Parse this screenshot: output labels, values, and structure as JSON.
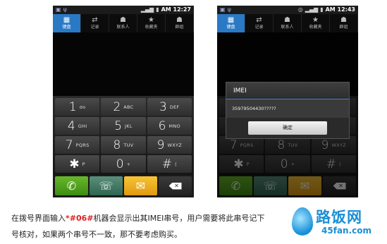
{
  "status_bar": {
    "left": {
      "time": "AM 12:27"
    },
    "right": {
      "time": "AM 12:43"
    }
  },
  "tabs": [
    {
      "label": "键盘",
      "icon": "keypad-icon",
      "glyph": "▦"
    },
    {
      "label": "记录",
      "icon": "call-log-icon",
      "glyph": "⇄"
    },
    {
      "label": "联系人",
      "icon": "contacts-icon",
      "glyph": "☗"
    },
    {
      "label": "收藏夹",
      "icon": "star-icon",
      "glyph": "★"
    },
    {
      "label": "群组",
      "icon": "group-icon",
      "glyph": "☗"
    }
  ],
  "keys": [
    [
      {
        "digit": "1",
        "letters": "σο"
      },
      {
        "digit": "2",
        "letters": "ABC"
      },
      {
        "digit": "3",
        "letters": "DEF"
      }
    ],
    [
      {
        "digit": "4",
        "letters": "GHI"
      },
      {
        "digit": "5",
        "letters": "JKL"
      },
      {
        "digit": "6",
        "letters": "MNO"
      }
    ],
    [
      {
        "digit": "7",
        "letters": "PQRS"
      },
      {
        "digit": "8",
        "letters": "TUV"
      },
      {
        "digit": "9",
        "letters": "WXYZ"
      }
    ],
    [
      {
        "digit": "✱",
        "letters": "P"
      },
      {
        "digit": "0",
        "letters": "+"
      },
      {
        "digit": "#",
        "letters": "⟨"
      }
    ]
  ],
  "actions": {
    "call": "✆",
    "add_contact": "☏",
    "message": "✉"
  },
  "dialog": {
    "title": "IMEI",
    "value": "35979504430?????",
    "ok_label": "确定"
  },
  "caption": {
    "part1": "在拨号界面输入",
    "code": "*#06#",
    "part2": "机器会显示出其IMEI串号，用户需要将此串号记下",
    "line2": "号核对，如果两个串号不一致，那不要考虑购买。"
  },
  "watermark": {
    "brand": "路饭网",
    "domain": "45fan.com"
  },
  "colors": {
    "tab_active": "#2a79c4",
    "call_button": "#4a9e1c",
    "message_button": "#f0b020",
    "caption_highlight": "#e02020"
  }
}
